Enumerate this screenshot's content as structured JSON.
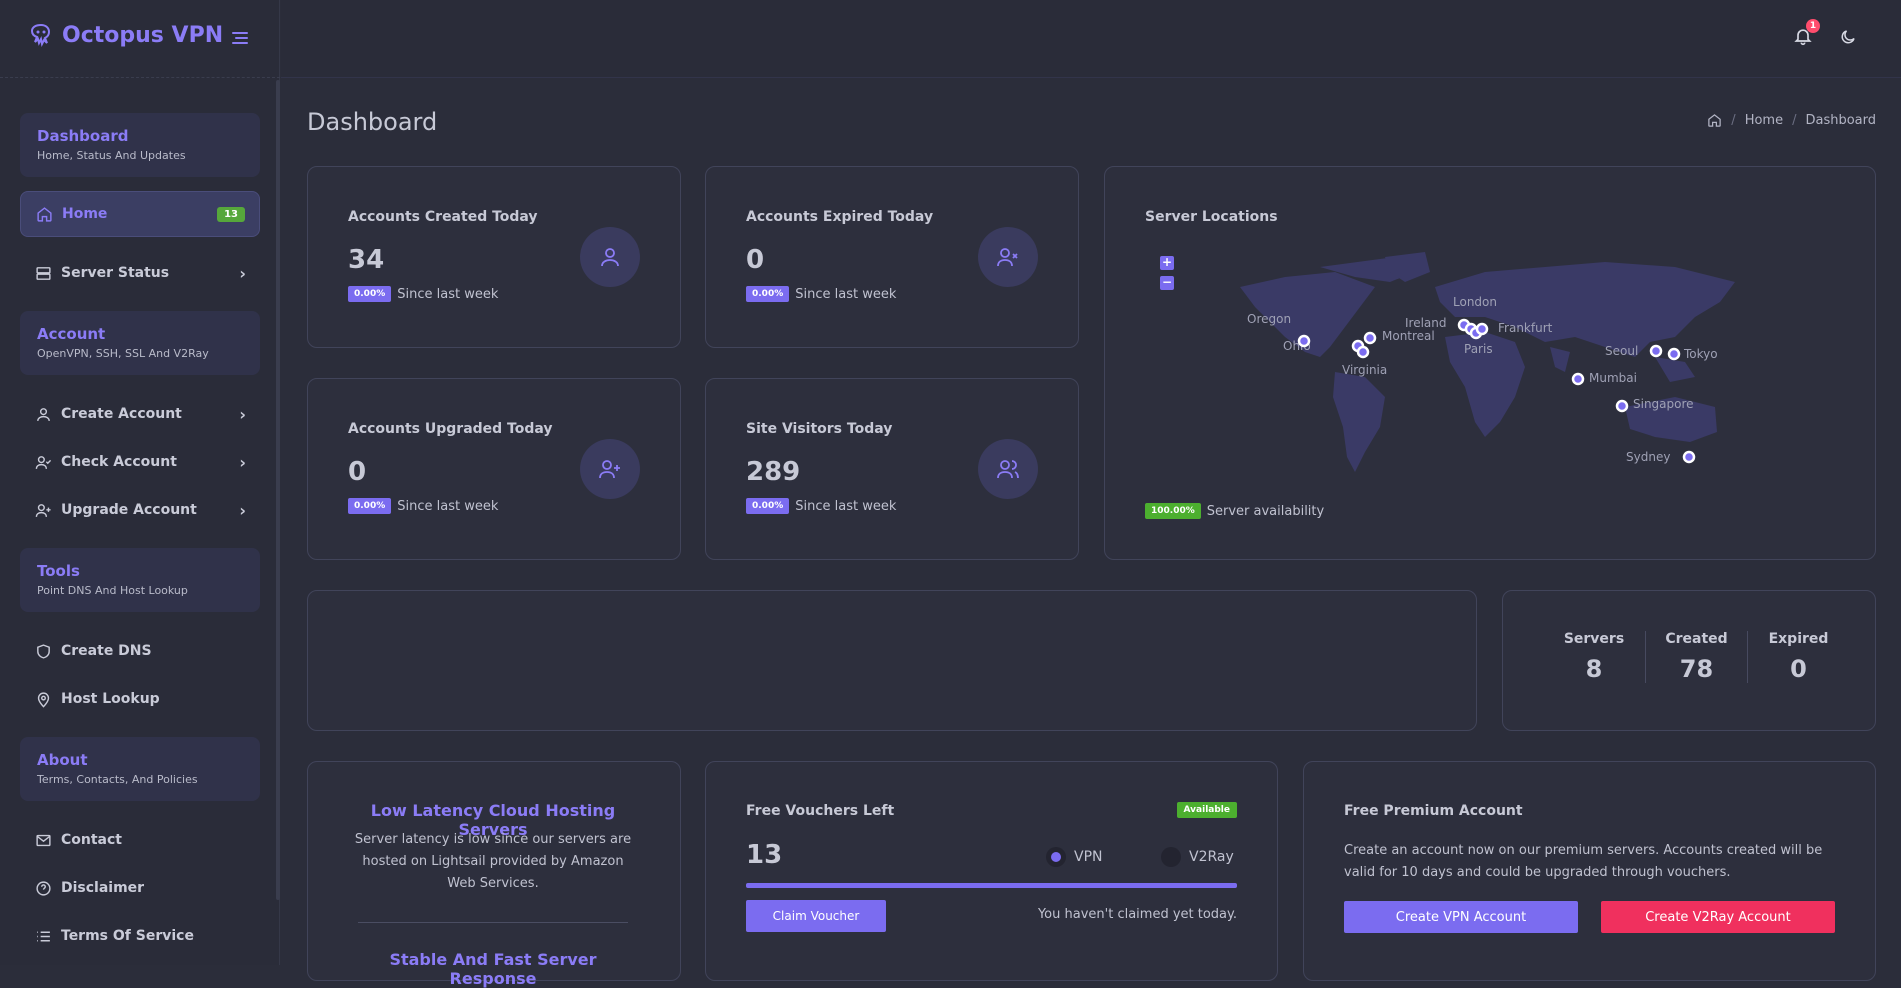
{
  "app": {
    "name": "Octopus VPN"
  },
  "header": {
    "notification_count": "1"
  },
  "sidebar": {
    "sections": [
      {
        "title": "Dashboard",
        "subtitle": "Home, Status And Updates"
      },
      {
        "title": "Account",
        "subtitle": "OpenVPN, SSH, SSL And V2Ray"
      },
      {
        "title": "Tools",
        "subtitle": "Point DNS And Host Lookup"
      },
      {
        "title": "About",
        "subtitle": "Terms, Contacts, And Policies"
      }
    ],
    "items": {
      "home": {
        "label": "Home",
        "badge": "13"
      },
      "server_status": {
        "label": "Server Status"
      },
      "create_account": {
        "label": "Create Account"
      },
      "check_account": {
        "label": "Check Account"
      },
      "upgrade_account": {
        "label": "Upgrade Account"
      },
      "create_dns": {
        "label": "Create DNS"
      },
      "host_lookup": {
        "label": "Host Lookup"
      },
      "contact": {
        "label": "Contact"
      },
      "disclaimer": {
        "label": "Disclaimer"
      },
      "terms": {
        "label": "Terms Of Service"
      }
    }
  },
  "page": {
    "title": "Dashboard"
  },
  "breadcrumb": {
    "home": "Home",
    "current": "Dashboard"
  },
  "stats": [
    {
      "title": "Accounts Created Today",
      "value": "34",
      "change": "0.00%",
      "since": "Since last week",
      "icon": "user-icon"
    },
    {
      "title": "Accounts Expired Today",
      "value": "0",
      "change": "0.00%",
      "since": "Since last week",
      "icon": "user-x-icon"
    },
    {
      "title": "Accounts Upgraded Today",
      "value": "0",
      "change": "0.00%",
      "since": "Since last week",
      "icon": "user-plus-icon"
    },
    {
      "title": "Site Visitors Today",
      "value": "289",
      "change": "0.00%",
      "since": "Since last week",
      "icon": "users-icon"
    }
  ],
  "map": {
    "title": "Server Locations",
    "zoom_in": "+",
    "zoom_out": "−",
    "locations": [
      "Oregon",
      "Ohio",
      "Montreal",
      "Virginia",
      "Ireland",
      "London",
      "Paris",
      "Frankfurt",
      "Seoul",
      "Tokyo",
      "Mumbai",
      "Singapore",
      "Sydney"
    ],
    "availability": "100.00%",
    "availability_label": "Server availability"
  },
  "counters": {
    "servers_label": "Servers",
    "servers": "8",
    "created_label": "Created",
    "created": "78",
    "expired_label": "Expired",
    "expired": "0"
  },
  "promo": {
    "title": "Low Latency Cloud Hosting Servers",
    "text": "Server latency is low since our servers are hosted on Lightsail provided by Amazon Web Services.",
    "title2": "Stable And Fast Server Response"
  },
  "vouchers": {
    "title": "Free Vouchers Left",
    "status": "Available",
    "count": "13",
    "option_vpn": "VPN",
    "option_v2ray": "V2Ray",
    "selected": "VPN",
    "progress": 1.0,
    "claim_button": "Claim Voucher",
    "note": "You haven't claimed yet today."
  },
  "premium": {
    "title": "Free Premium Account",
    "text": "Create an account now on our premium servers. Accounts created will be valid for 10 days and could be upgraded through vouchers.",
    "vpn_button": "Create VPN Account",
    "v2ray_button": "Create V2Ray Account"
  },
  "colors": {
    "accent": "#7b6cf0",
    "success": "#4caf2f",
    "danger": "#f0305e",
    "background": "#2b2d3a"
  }
}
